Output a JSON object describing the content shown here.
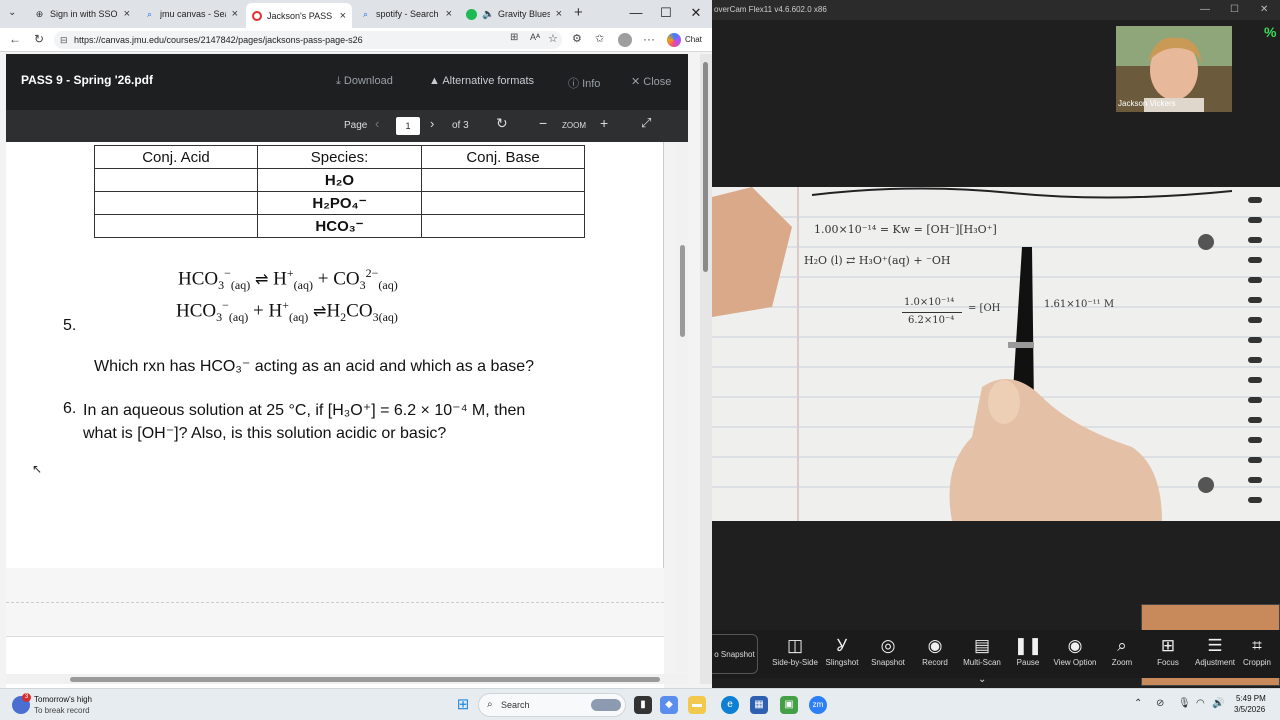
{
  "browser": {
    "tabs": [
      {
        "label": "Sign in with SSO - 2"
      },
      {
        "label": "jmu canvas - Search"
      },
      {
        "label": "Jackson's PASS Page"
      },
      {
        "label": "spotify - Search"
      },
      {
        "label": "Gravity Blues -"
      }
    ],
    "url": "https://canvas.jmu.edu/courses/2147842/pages/jacksons-pass-page-s26",
    "chat_label": "Chat"
  },
  "pdf": {
    "title": "PASS 9 - Spring '26.pdf",
    "download": "Download",
    "alt_formats": "Alternative formats",
    "info": "Info",
    "close": "Close",
    "page_label": "Page",
    "page_value": "1",
    "page_of": "of 3",
    "zoom_label": "ZOOM"
  },
  "worksheet": {
    "table_headers": [
      "Conj. Acid",
      "Species:",
      "Conj. Base"
    ],
    "species": [
      "H₂O",
      "H₂PO₄⁻",
      "HCO₃⁻"
    ],
    "q5_number": "5.",
    "q5_text": "Which rxn has HCO₃⁻ acting as an acid and which as a base?",
    "q6_number": "6.",
    "q6_line1": "In an aqueous solution at 25 °C, if [H₃O⁺] = 6.2 × 10⁻⁴ M, then",
    "q6_line2": "what is [OH⁻]? Also, is this solution acidic or basic?"
  },
  "camera_app": {
    "title": "overCam Flex11 v4.6.602.0 x86",
    "participant": "Jackson Vickers",
    "percent": "%",
    "notes": {
      "line1": "1.00×10⁻¹⁴ = Kw = [OH⁻][H₃O⁺]",
      "line2": "H₂O (l) ⇄ H₃O⁺(aq) + ⁻OH",
      "frac_num": "1.0×10⁻¹⁴",
      "frac_den": "6.2×10⁻⁴",
      "frac_eq": "= [OH",
      "result": "1.61×10⁻¹¹ M"
    },
    "snapshot_tab": "o Snapshot",
    "tools": [
      "Side-by-Side",
      "Slingshot",
      "Snapshot",
      "Record",
      "Multi-Scan",
      "Pause",
      "View Option",
      "Zoom",
      "Focus",
      "Adjustment",
      "Croppin"
    ]
  },
  "taskbar": {
    "weather_title": "Tomorrow's high",
    "weather_sub": "To break record",
    "search": "Search",
    "time": "5:49 PM",
    "date": "3/5/2026"
  }
}
